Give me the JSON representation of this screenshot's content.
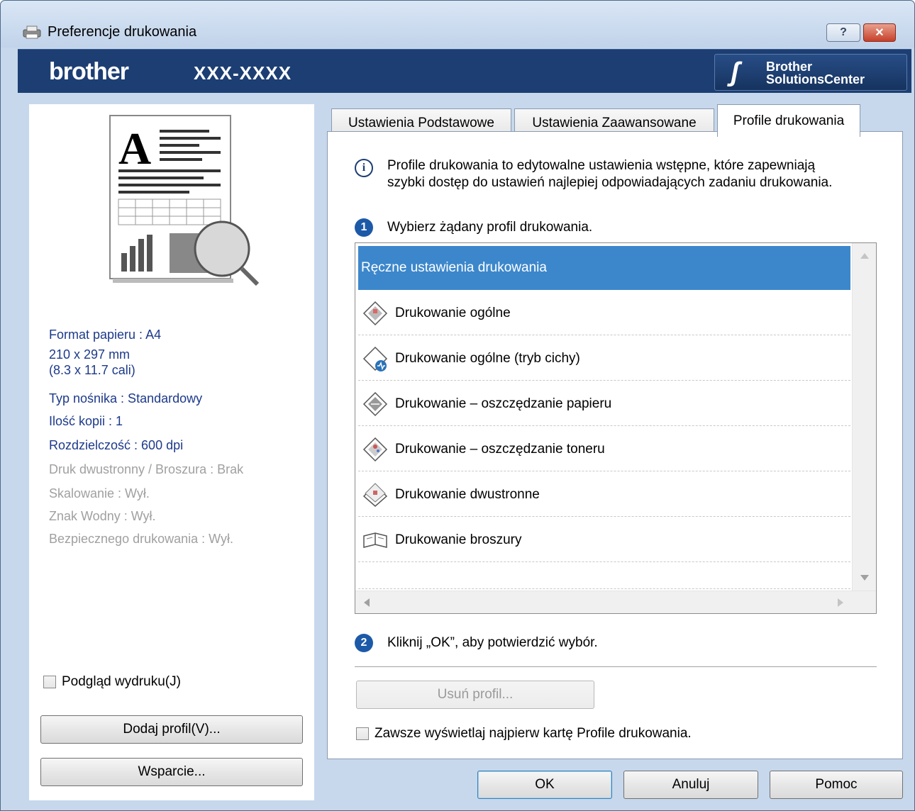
{
  "window": {
    "title": "Preferencje drukowania",
    "help_button": "?",
    "close_button": "✕"
  },
  "brand": {
    "logo": "brother",
    "model": "XXX-XXXX",
    "solutions_line1": "Brother",
    "solutions_line2": "SolutionsCenter",
    "bar_color": "#1c3e73"
  },
  "summary": {
    "paper_format": "Format papieru  : A4",
    "paper_size_mm": "210 x 297 mm",
    "paper_size_in": "(8.3 x 11.7 cali)",
    "media_type": "Typ nośnika : Standardowy",
    "copies": "Ilość kopii  : 1",
    "resolution": "Rozdzielczość : 600 dpi",
    "duplex": "Druk dwustronny / Broszura : Brak",
    "scaling": "Skalowanie : Wył.",
    "watermark": "Znak Wodny : Wył.",
    "secure_print": "Bezpiecznego drukowania : Wył."
  },
  "left": {
    "preview_checkbox": "Podgląd wydruku(J)",
    "add_profile": "Dodaj profil(V)...",
    "support": "Wsparcie..."
  },
  "tabs": [
    {
      "label": "Ustawienia Podstawowe"
    },
    {
      "label": "Ustawienia Zaawansowane"
    },
    {
      "label": "Profile drukowania"
    }
  ],
  "profiles_tab": {
    "description_line1": "Profile drukowania to edytowalne ustawienia wstępne, które zapewniają",
    "description_line2": "szybki dostęp do ustawień najlepiej odpowiadających zadaniu drukowania.",
    "step1_number": "1",
    "step1_text": "Wybierz żądany profil drukowania.",
    "step2_number": "2",
    "step2_text": "Kliknij „OK”, aby potwierdzić wybór.",
    "profiles": [
      {
        "label": "Ręczne ustawienia drukowania",
        "selected": true,
        "icon": "none"
      },
      {
        "label": "Drukowanie ogólne",
        "icon": "general-print-icon"
      },
      {
        "label": "Drukowanie ogólne (tryb cichy)",
        "icon": "quiet-mode-icon"
      },
      {
        "label": "Drukowanie – oszczędzanie papieru",
        "icon": "paper-saving-icon"
      },
      {
        "label": "Drukowanie – oszczędzanie toneru",
        "icon": "toner-saving-icon"
      },
      {
        "label": "Drukowanie dwustronne",
        "icon": "duplex-icon"
      },
      {
        "label": "Drukowanie broszury",
        "icon": "booklet-icon"
      }
    ],
    "delete_profile": "Usuń profil...",
    "always_show_checkbox": "Zawsze wyświetlaj najpierw kartę Profile drukowania."
  },
  "footer": {
    "ok": "OK",
    "cancel": "Anuluj",
    "help": "Pomoc"
  },
  "colors": {
    "selection": "#3c87cc",
    "info_text": "#1d3a8a",
    "disabled_text": "#a0a0a0"
  }
}
